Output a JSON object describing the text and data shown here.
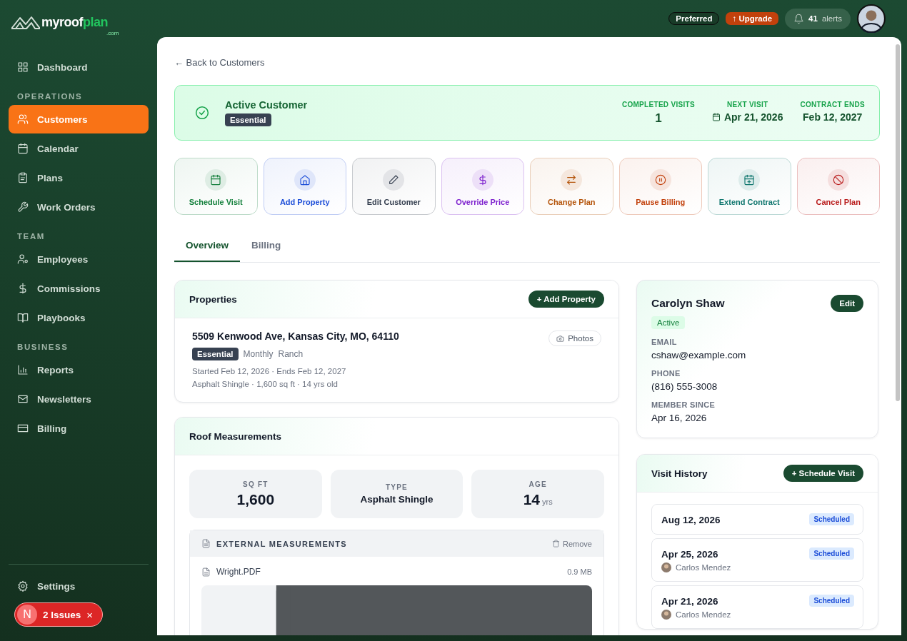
{
  "brand": {
    "name": "myroof",
    "accent": "plan",
    "suffix": ".com"
  },
  "nav": [
    {
      "items": [
        {
          "label": "Dashboard",
          "kind": "grid",
          "selected": false
        }
      ]
    },
    {
      "heading": "OPERATIONS",
      "items": [
        {
          "label": "Customers",
          "kind": "users",
          "selected": true
        },
        {
          "label": "Calendar",
          "kind": "calendar",
          "selected": false
        },
        {
          "label": "Plans",
          "kind": "clipboard",
          "selected": false
        },
        {
          "label": "Work Orders",
          "kind": "wrench",
          "selected": false
        }
      ]
    },
    {
      "heading": "TEAM",
      "items": [
        {
          "label": "Employees",
          "kind": "employee",
          "selected": false
        },
        {
          "label": "Commissions",
          "kind": "dollar",
          "selected": false
        },
        {
          "label": "Playbooks",
          "kind": "book",
          "selected": false
        }
      ]
    },
    {
      "heading": "BUSINESS",
      "items": [
        {
          "label": "Reports",
          "kind": "chart",
          "selected": false
        },
        {
          "label": "Newsletters",
          "kind": "mail",
          "selected": false
        },
        {
          "label": "Billing",
          "kind": "card",
          "selected": false
        }
      ]
    }
  ],
  "settings": {
    "label": "Settings",
    "kind": "gear"
  },
  "issues": {
    "initial": "N",
    "label": "2 Issues",
    "close": "×"
  },
  "topbar": {
    "plan_badge": "Preferred",
    "upgrade": "↑ Upgrade",
    "alerts_count": "41",
    "alerts_label": "alerts"
  },
  "back_link": "← Back to Customers",
  "status_banner": {
    "title": "Active Customer",
    "plan": "Essential",
    "stats": [
      {
        "label": "COMPLETED VISITS",
        "value": "1",
        "kind": "count"
      },
      {
        "label": "NEXT VISIT",
        "value": "Apr 21, 2026",
        "kind": "date"
      },
      {
        "label": "CONTRACT ENDS",
        "value": "Feb 12, 2027",
        "kind": "plain"
      }
    ]
  },
  "actions": [
    {
      "label": "Schedule Visit",
      "kind": "calendar",
      "color": "#15803d"
    },
    {
      "label": "Add Property",
      "kind": "home",
      "color": "#1d4ed8"
    },
    {
      "label": "Edit Customer",
      "kind": "pencil",
      "color": "#374151"
    },
    {
      "label": "Override Price",
      "kind": "dollar",
      "color": "#7e22ce"
    },
    {
      "label": "Change Plan",
      "kind": "swap",
      "color": "#b45309"
    },
    {
      "label": "Pause Billing",
      "kind": "pause",
      "color": "#c2410c"
    },
    {
      "label": "Extend Contract",
      "kind": "calendar-plus",
      "color": "#0f766e"
    },
    {
      "label": "Cancel Plan",
      "kind": "ban",
      "color": "#b91c1c"
    }
  ],
  "tabs": [
    {
      "label": "Overview",
      "selected": true
    },
    {
      "label": "Billing",
      "selected": false
    }
  ],
  "properties": {
    "title": "Properties",
    "add_button": "+ Add Property",
    "items": [
      {
        "address": "5509 Kenwood Ave, Kansas City, MO, 64110",
        "plan": "Essential",
        "tags": [
          "Monthly",
          "Ranch"
        ],
        "dates": "Started Feb 12, 2026 · Ends Feb 12, 2027",
        "details": "Asphalt Shingle · 1,600 sq ft · 14 yrs old",
        "photos": "Photos"
      }
    ]
  },
  "roof": {
    "title": "Roof Measurements",
    "stats": [
      {
        "label": "SQ FT",
        "value": "1,600",
        "kind": "number"
      },
      {
        "label": "TYPE",
        "value": "Asphalt Shingle",
        "kind": "text"
      },
      {
        "label": "AGE",
        "value": "14",
        "unit": "yrs",
        "kind": "number"
      }
    ],
    "external": {
      "title": "EXTERNAL MEASUREMENTS",
      "remove": "Remove",
      "file": "Wright.PDF",
      "size": "0.9 MB"
    }
  },
  "customer": {
    "name": "Carolyn Shaw",
    "edit": "Edit",
    "status": "Active",
    "fields": [
      {
        "label": "EMAIL",
        "value": "cshaw@example.com"
      },
      {
        "label": "PHONE",
        "value": "(816) 555-3008"
      },
      {
        "label": "MEMBER SINCE",
        "value": "Apr 16, 2026"
      }
    ]
  },
  "visits": {
    "title": "Visit History",
    "add_button": "+ Schedule Visit",
    "items": [
      {
        "date": "Aug 12, 2026",
        "status": "Scheduled"
      },
      {
        "date": "Apr 25, 2026",
        "status": "Scheduled",
        "tech": "Carlos Mendez"
      },
      {
        "date": "Apr 21, 2026",
        "status": "Scheduled",
        "tech": "Carlos Mendez"
      }
    ]
  }
}
